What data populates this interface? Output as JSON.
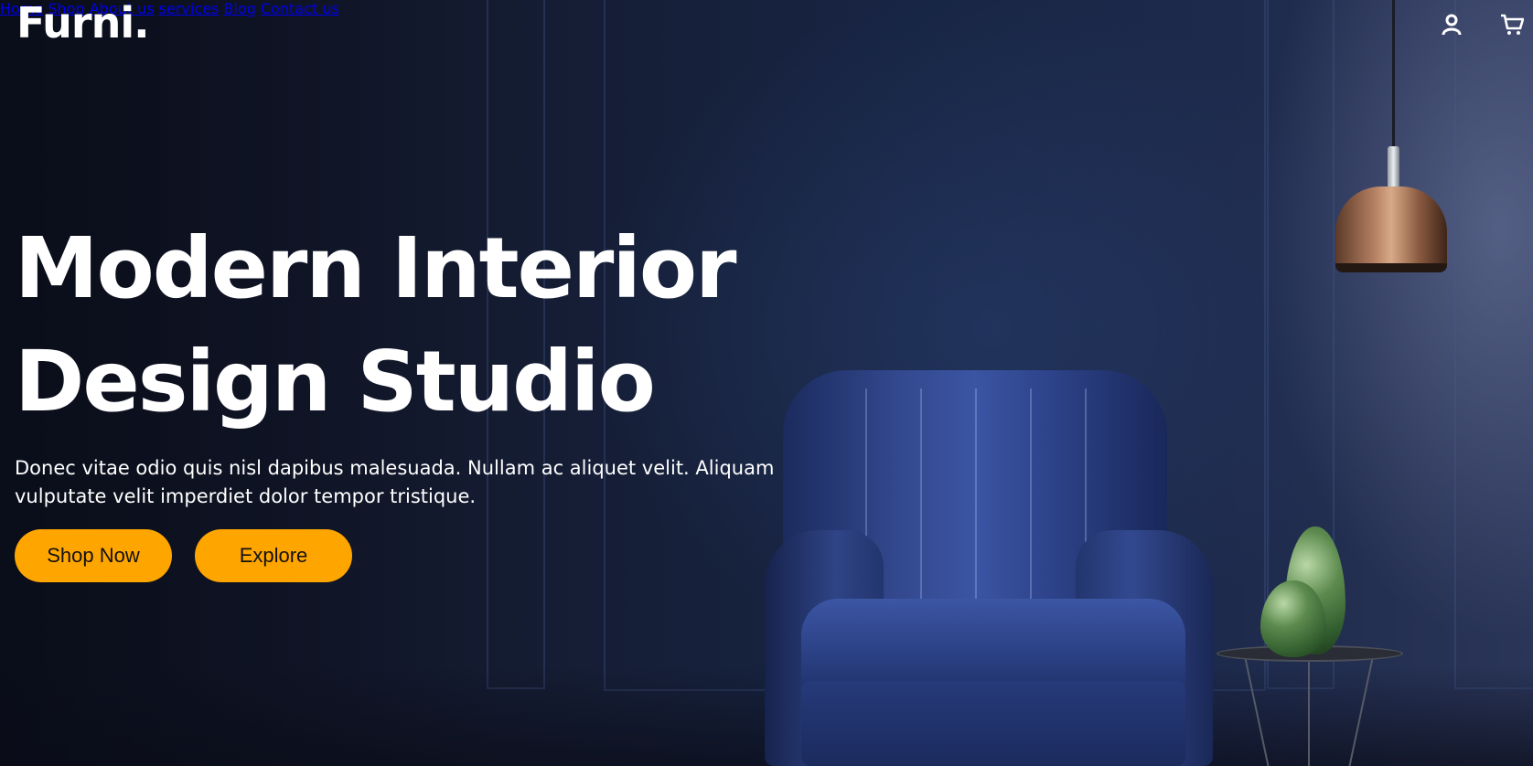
{
  "header": {
    "logo": "Furni.",
    "nav": [
      {
        "label": "Home"
      },
      {
        "label": "Shop"
      },
      {
        "label": "About us"
      },
      {
        "label": "services"
      },
      {
        "label": "Blog"
      },
      {
        "label": "Contact us"
      }
    ],
    "icons": {
      "account": "user-icon",
      "cart": "cart-icon"
    }
  },
  "hero": {
    "title_line1": "Modern Interior",
    "title_line2": "Design Studio",
    "description": "Donec vitae odio quis nisl dapibus malesuada. Nullam ac aliquet velit. Aliquam vulputate velit imperdiet dolor tempor tristique.",
    "primary_button": "Shop Now",
    "secondary_button": "Explore"
  },
  "colors": {
    "accent": "#ffa500",
    "background": "#131a2e",
    "text": "#ffffff"
  }
}
